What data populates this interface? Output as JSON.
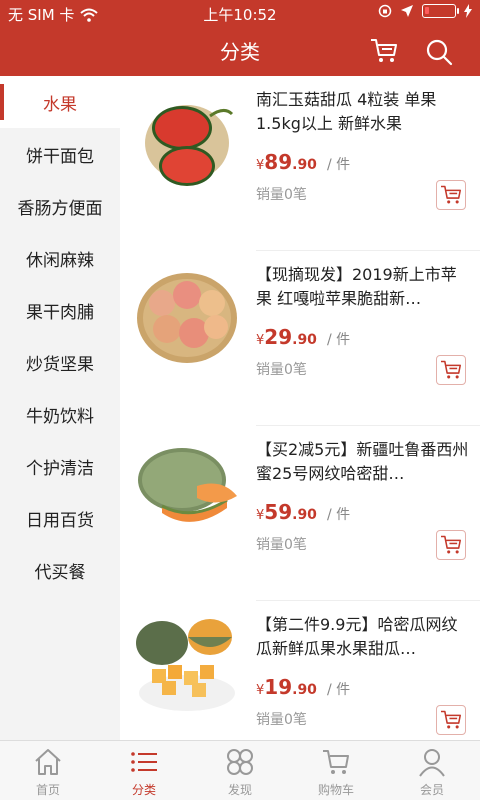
{
  "status_bar": {
    "carrier": "无 SIM 卡",
    "time": "上午10:52"
  },
  "nav": {
    "title": "分类",
    "cart_icon": "cart-icon",
    "search_icon": "search-icon"
  },
  "sidebar": {
    "items": [
      {
        "label": "水果",
        "active": true
      },
      {
        "label": "饼干面包",
        "active": false
      },
      {
        "label": "香肠方便面",
        "active": false
      },
      {
        "label": "休闲麻辣",
        "active": false
      },
      {
        "label": "果干肉脯",
        "active": false
      },
      {
        "label": "炒货坚果",
        "active": false
      },
      {
        "label": "牛奶饮料",
        "active": false
      },
      {
        "label": "个护清洁",
        "active": false
      },
      {
        "label": "日用百货",
        "active": false
      },
      {
        "label": "代买餐",
        "active": false
      }
    ]
  },
  "products": [
    {
      "title": "南汇玉菇甜瓜 4粒装 单果1.5kg以上 新鲜水果",
      "currency": "¥",
      "price_int": "89",
      "price_dec": ".90",
      "unit": "/ 件",
      "sales": "销量0笔",
      "image": "watermelon"
    },
    {
      "title": "【现摘现发】2019新上市苹果 红嘎啦苹果脆甜新…",
      "currency": "¥",
      "price_int": "29",
      "price_dec": ".90",
      "unit": "/ 件",
      "sales": "销量0笔",
      "image": "apples"
    },
    {
      "title": "【买2减5元】新疆吐鲁番西州蜜25号网纹哈密甜…",
      "currency": "¥",
      "price_int": "59",
      "price_dec": ".90",
      "unit": "/ 件",
      "sales": "销量0笔",
      "image": "hami-melon"
    },
    {
      "title": "【第二件9.9元】哈密瓜网纹瓜新鲜瓜果水果甜瓜…",
      "currency": "¥",
      "price_int": "19",
      "price_dec": ".90",
      "unit": "/ 件",
      "sales": "销量0笔",
      "image": "cut-melon"
    }
  ],
  "tabbar": {
    "tabs": [
      {
        "label": "首页",
        "icon": "home-icon",
        "active": false
      },
      {
        "label": "分类",
        "icon": "list-icon",
        "active": true
      },
      {
        "label": "发现",
        "icon": "discover-icon",
        "active": false
      },
      {
        "label": "购物车",
        "icon": "cart-icon",
        "active": false
      },
      {
        "label": "会员",
        "icon": "user-icon",
        "active": false
      }
    ]
  },
  "colors": {
    "brand": "#c4392b",
    "sidebar_bg": "#f3f3f3",
    "muted": "#999999"
  }
}
